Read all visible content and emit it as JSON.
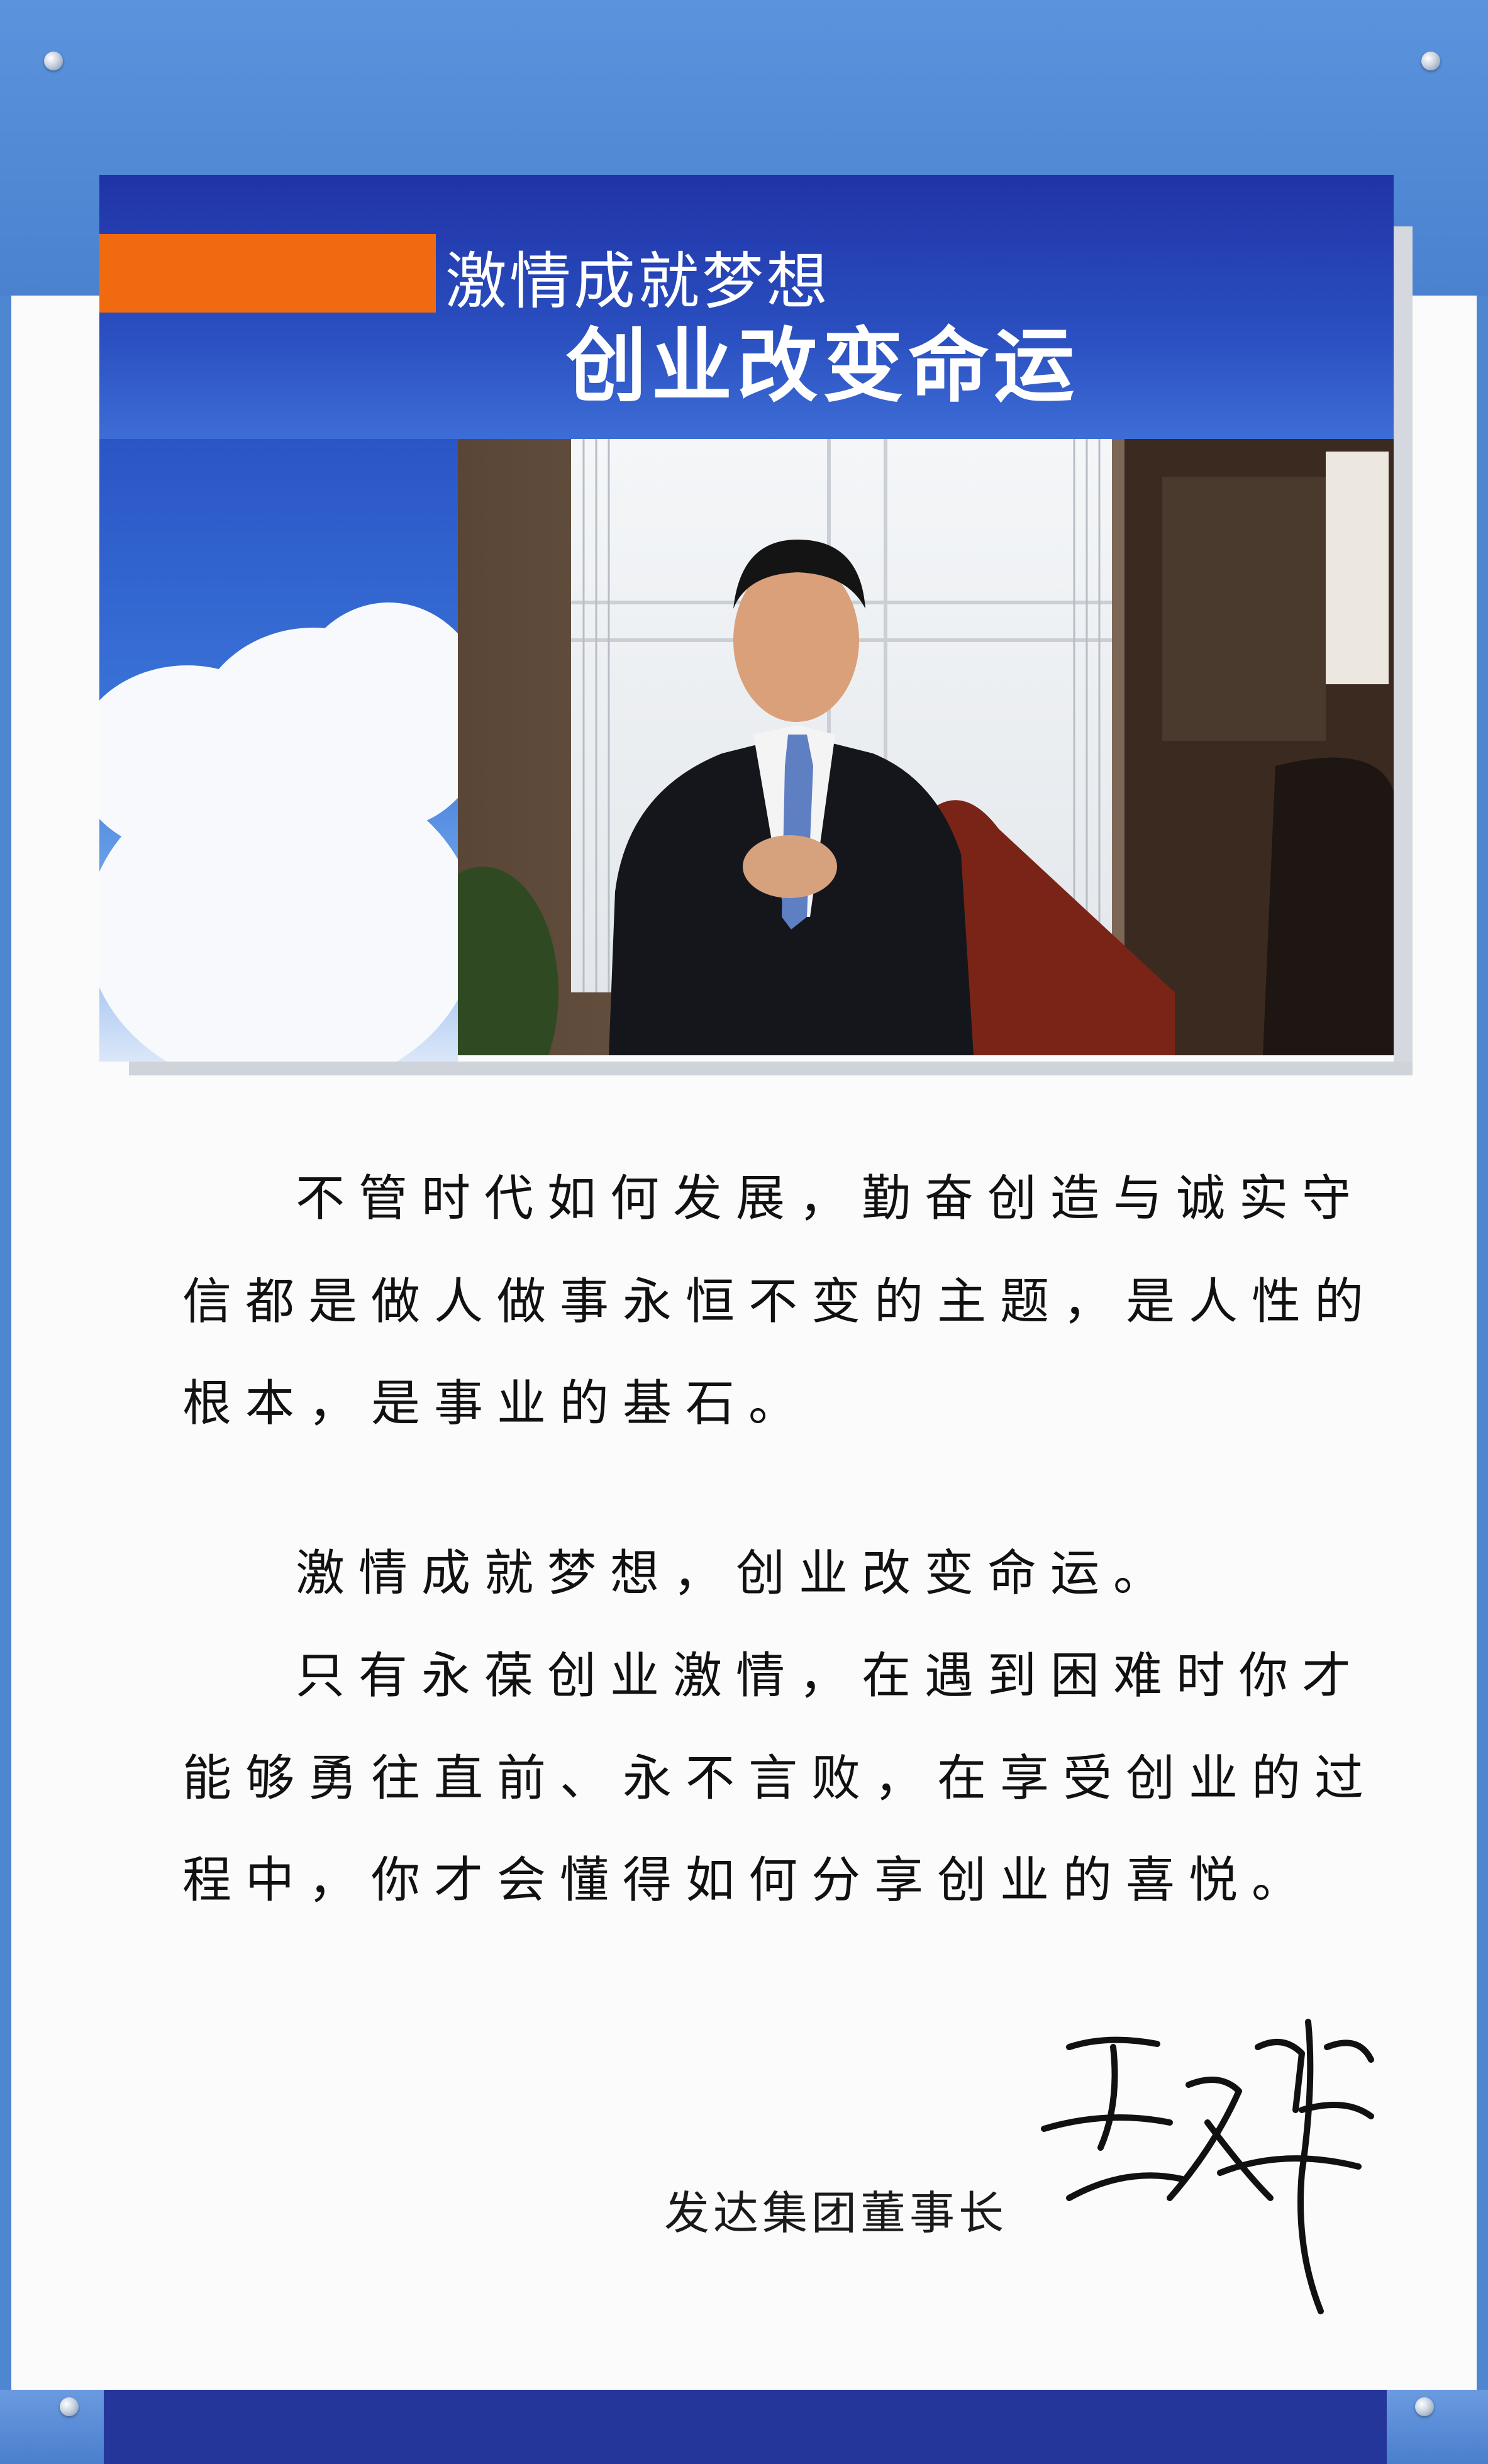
{
  "header": {
    "title_line1": "激情成就梦想",
    "title_line2": "创业改变命运"
  },
  "body": {
    "paragraphs": [
      "不管时代如何发展，勤奋创造与诚实守信都是做人做事永恒不变的主题，是人性的根本，是事业的基石。",
      "激情成就梦想，创业改变命运。",
      "只有永葆创业激情，在遇到困难时你才能够勇往直前、永不言败，在享受创业的过程中，你才会懂得如何分享创业的喜悦。"
    ],
    "lines": [
      "不管时代如何发展，勤奋创造与诚实守",
      "信都是做人做事永恒不变的主题，是人性的",
      "根本，是事业的基石。",
      "激情成就梦想，创业改变命运。",
      "只有永葆创业激情，在遇到困难时你才",
      "能够勇往直前、永不言败，在享受创业的过",
      "程中，你才会懂得如何分享创业的喜悦。"
    ]
  },
  "signature": {
    "label": "发达集团董事长",
    "name": "王文峰"
  },
  "colors": {
    "banner_blue": "#2033a6",
    "accent_orange": "#f26a10",
    "frame_blue": "#4f86d2"
  }
}
